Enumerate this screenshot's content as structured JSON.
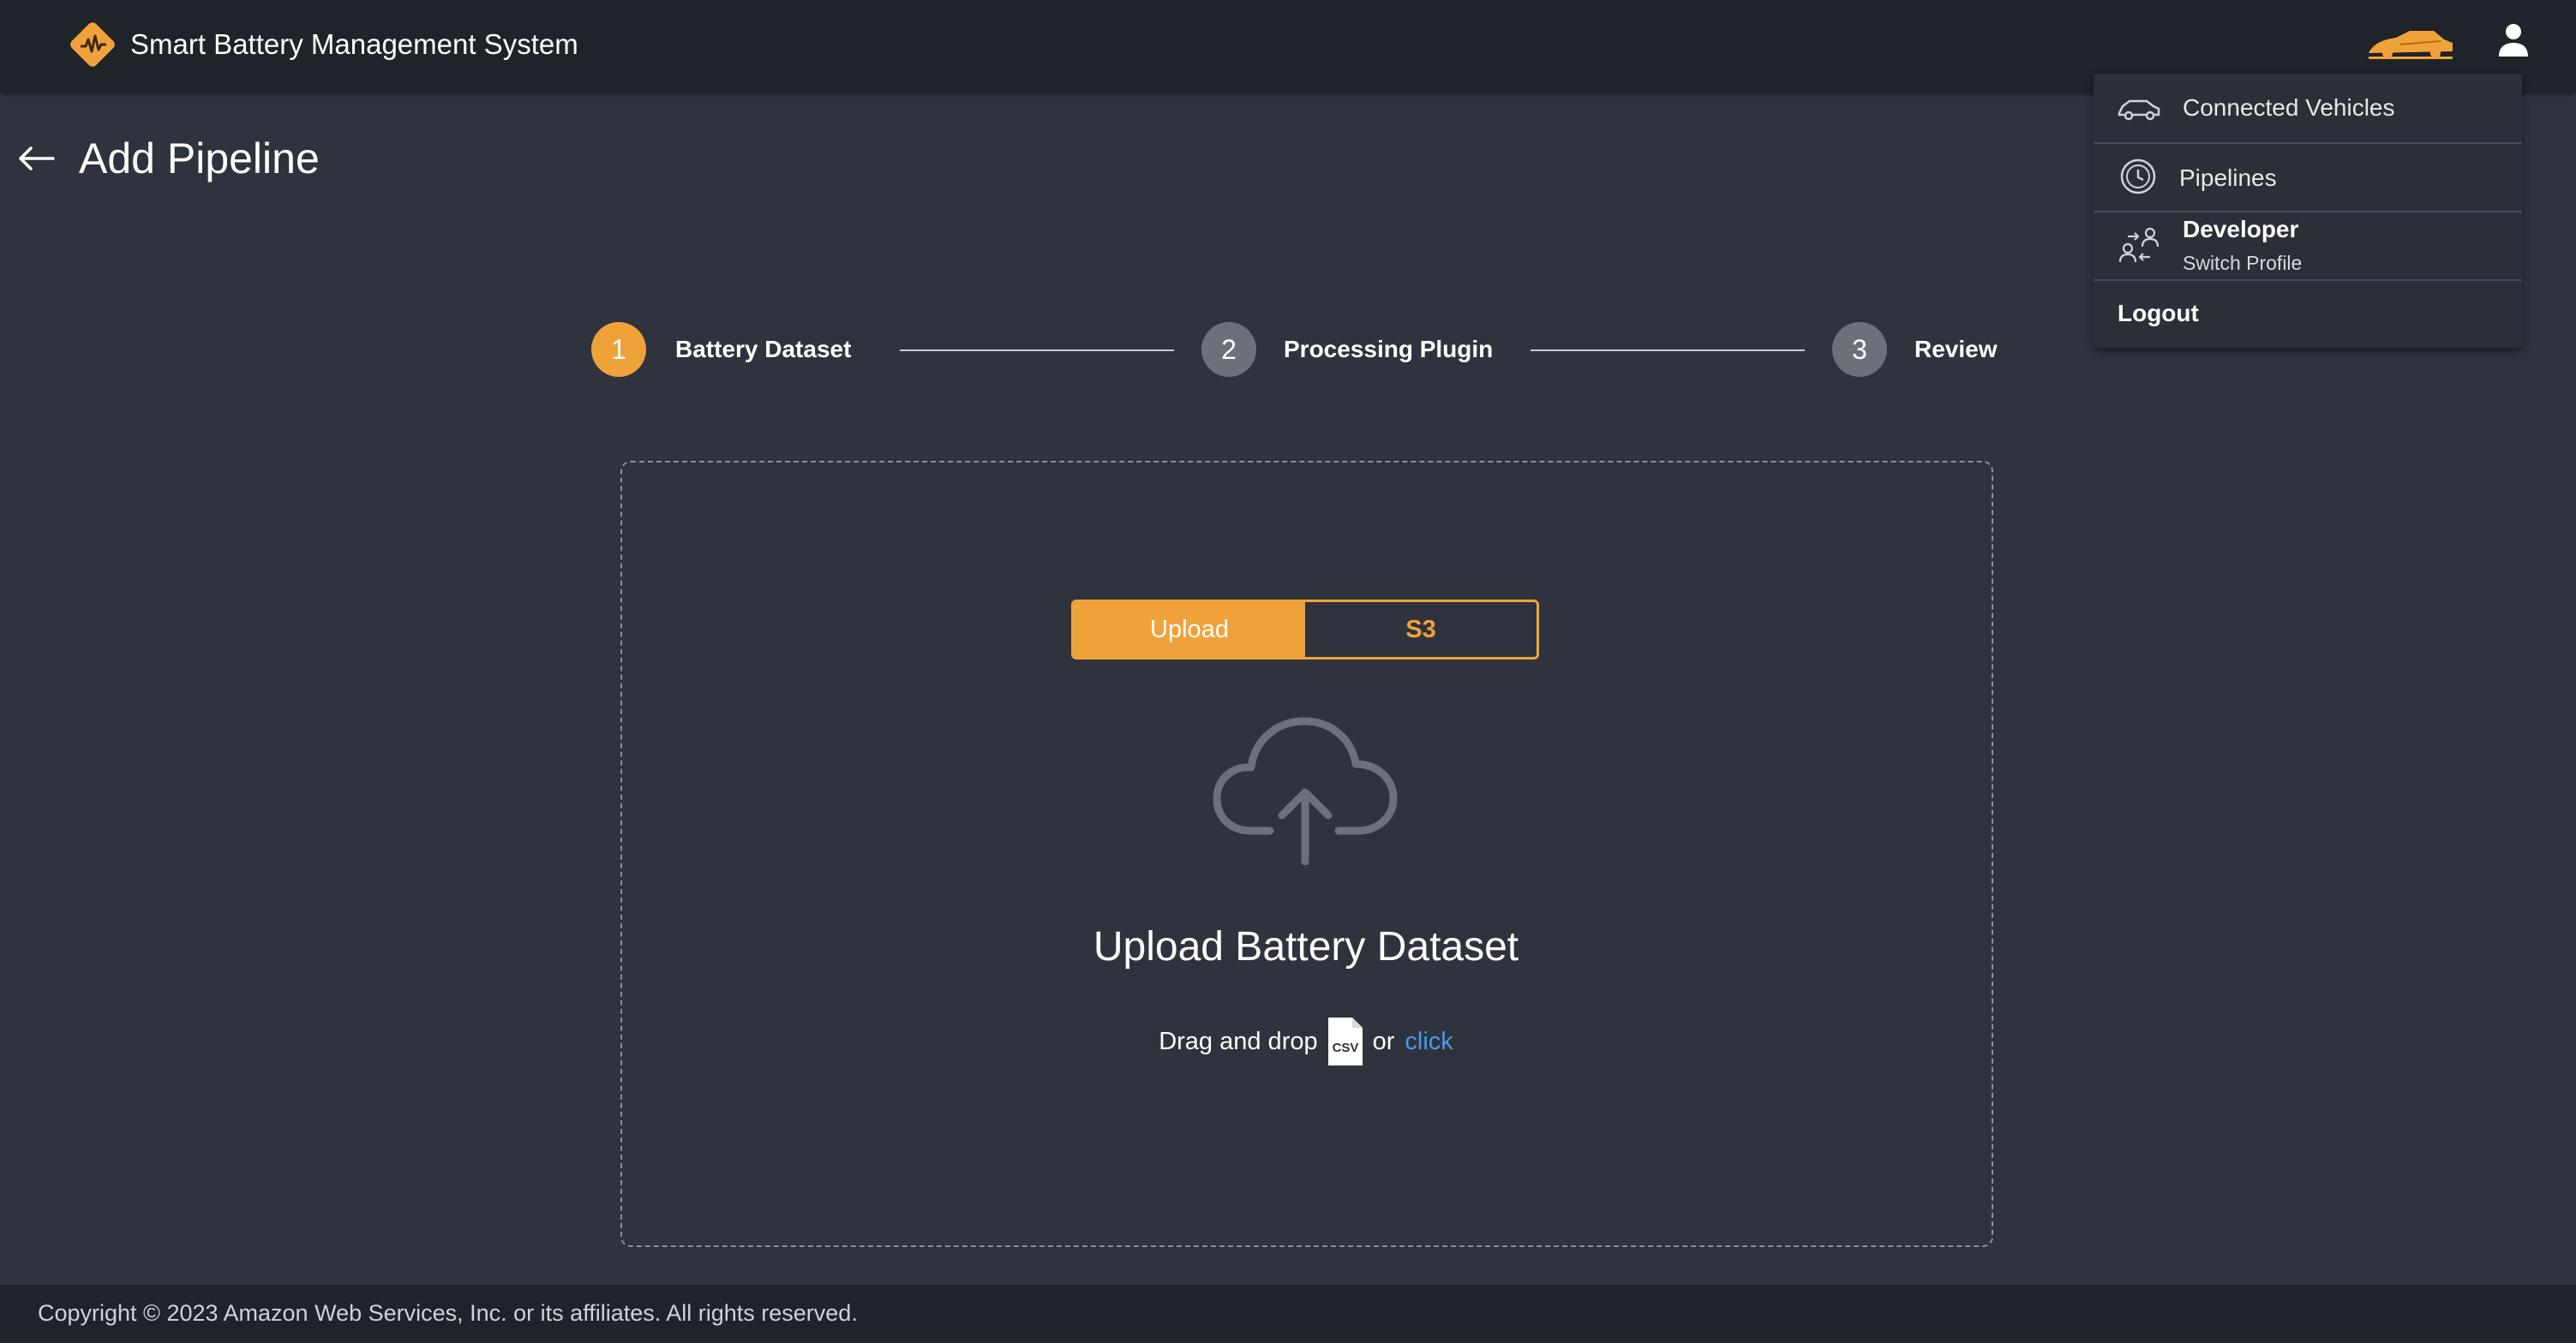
{
  "app": {
    "title": "Smart Battery Management System"
  },
  "user_menu": {
    "items": [
      {
        "label": "Connected Vehicles",
        "icon": "car-icon"
      },
      {
        "label": "Pipelines",
        "icon": "pipeline-clock-icon"
      }
    ],
    "profile": {
      "name": "Developer",
      "action": "Switch Profile",
      "icon": "switch-profile-icon"
    },
    "logout_label": "Logout"
  },
  "page": {
    "title": "Add Pipeline"
  },
  "stepper": {
    "steps": [
      {
        "number": "1",
        "label": "Battery Dataset",
        "active": true
      },
      {
        "number": "2",
        "label": "Processing Plugin",
        "active": false
      },
      {
        "number": "3",
        "label": "Review",
        "active": false
      }
    ]
  },
  "upload": {
    "tabs": {
      "upload": "Upload",
      "s3": "S3"
    },
    "selected_tab": "Upload",
    "title": "Upload Battery Dataset",
    "drag_text": "Drag and drop",
    "file_type_label": "CSV",
    "or_text": "or",
    "click_text": "click"
  },
  "footer": {
    "copyright": "Copyright © 2023 Amazon Web Services, Inc. or its affiliates. All rights reserved."
  },
  "colors": {
    "accent": "#f0a23a",
    "topbar": "#1f232a",
    "background": "#2f333d",
    "inactive_step": "#6b7079",
    "link": "#4a9be8"
  }
}
